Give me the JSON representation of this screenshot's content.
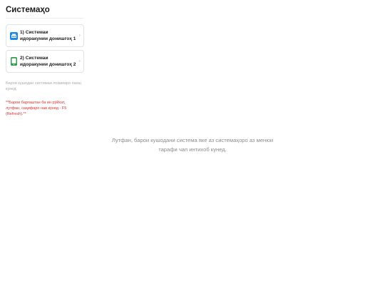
{
  "sidebar": {
    "title": "Системаҳо",
    "items": [
      {
        "label": "1) Системаи идоракунии донишгоҳ 1",
        "icon": "university-system-icon",
        "color": "#1e88e5"
      },
      {
        "label": "2) Системаи идоракунии донишгоҳ 2",
        "icon": "mobile-system-icon",
        "color": "#2e9e4f"
      }
    ],
    "hint": "Барои кушодан системаи лозимаро пахш кунед.",
    "warning": "**Барои баргаштан ба ин рӯйхат, лутфан, саҳифаро нав кунед - F5 (Refresh).**"
  },
  "main": {
    "message": "Лутфан, барои кушодани система яке аз системаҳоро аз менюи тарафи чап интихоб кунед."
  }
}
